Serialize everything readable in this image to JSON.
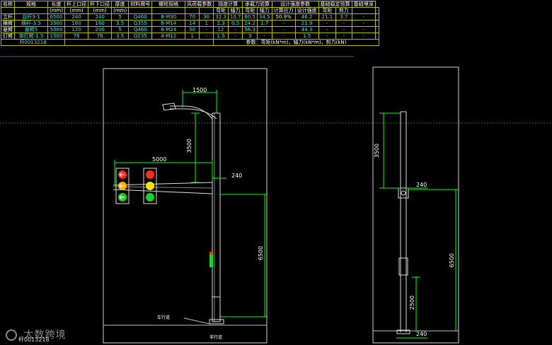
{
  "spec_table": {
    "header": [
      "名称",
      "规格",
      "长度",
      "杆上口径",
      "杆下口径",
      "厚度",
      "材料牌号",
      "螺栓规格",
      "风荷载参数",
      "",
      "挠度计算",
      "",
      "承载力验算",
      "",
      "设计强度参数",
      "",
      "",
      "基础稳定验算",
      "",
      "基础埋深"
    ],
    "units": [
      "",
      "",
      "(mm)",
      "(mm)",
      "(mm)",
      "(mm)",
      "",
      "",
      "",
      "",
      "弯矩",
      "轴力",
      "弯矩",
      "轴力",
      "计算应力",
      "设计强度",
      "",
      "弯矩",
      "剪力",
      ""
    ],
    "rows": [
      [
        "立杆",
        "台杆3-1",
        "6500",
        "240",
        "240",
        "5",
        "Q460",
        "8-M30",
        "70",
        "30",
        "32.3",
        "10.7",
        "60.5",
        "34.5",
        "50.9%",
        "46.2",
        "",
        "21.1",
        "3.7",
        "-"
      ],
      [
        "横臂",
        "横杆-3.5",
        "3500",
        "160",
        "160",
        "3.5",
        "Q355",
        "6-M14",
        "14",
        "1",
        "2.3",
        "0.5",
        "24.2",
        "1.7",
        "-",
        "21.9",
        "",
        "-",
        "-",
        "-"
      ],
      [
        "悬臂",
        "悬臂5",
        "5000",
        "120",
        "200",
        "5",
        "Q460",
        "6-M24",
        "50",
        "-",
        "12",
        "-",
        "56.3",
        "-",
        "-",
        "44.3",
        "",
        "-",
        "-",
        "-"
      ],
      [
        "灯臂",
        "单灯臂-1.5",
        "1500",
        "76",
        "76",
        "3.5",
        "Q235",
        "4-M12",
        "1",
        "-",
        "1.5",
        "-",
        "3",
        "-",
        "-",
        "1.5",
        "",
        "-",
        "-",
        "-"
      ]
    ],
    "code": "杆0013218",
    "note": "参数：弯矩(kN*m)，轴力(kN*m)，剪力(kN)"
  },
  "front_view": {
    "dim_lamp_arm": "1500",
    "dim_top_height": "3500",
    "dim_cantilever": "5000",
    "dim_pole_width": "240",
    "dim_pole_height": "6500",
    "label_sidewalk": "非行道",
    "label_ground": "车行道",
    "label_base": "杆0013218"
  },
  "side_view": {
    "dim_top_height": "3500",
    "dim_pole_width": "240",
    "dim_pole_height": "6500",
    "dim_lower": "2500",
    "dim_base_width": "240"
  },
  "watermark": {
    "text": "太数跨境",
    "code": "杆0013218"
  },
  "colors": {
    "table_border": "#b8b800",
    "dimension": "#00ff00",
    "red": "#ff2a1a",
    "amber": "#ffb300",
    "green": "#1fd21f"
  }
}
